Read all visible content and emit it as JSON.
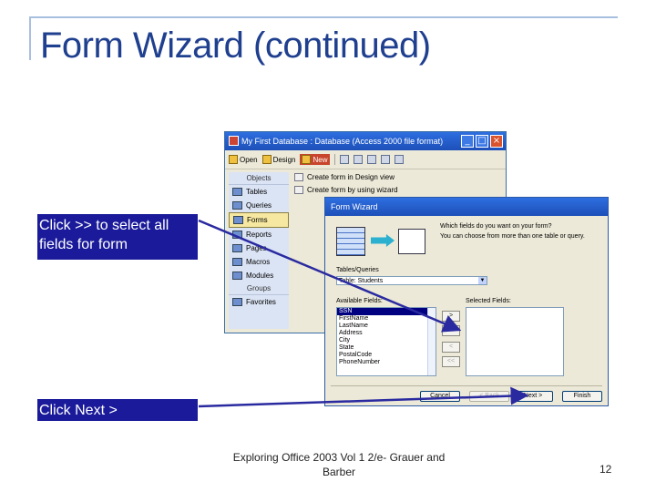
{
  "slide": {
    "title": "Form Wizard (continued)",
    "footer": "Exploring Office 2003 Vol 1 2/e- Grauer and Barber",
    "page_number": "12"
  },
  "db_window": {
    "title": "My First Database : Database (Access 2000 file format)",
    "toolbar": {
      "open": "Open",
      "design": "Design",
      "new": "New"
    },
    "sidebar": {
      "objects_header": "Objects",
      "items": [
        "Tables",
        "Queries",
        "Forms",
        "Reports",
        "Pages",
        "Macros",
        "Modules"
      ],
      "groups_header": "Groups",
      "favorites": "Favorites",
      "selected": "Forms"
    },
    "list": [
      "Create form in Design view",
      "Create form by using wizard"
    ]
  },
  "wizard": {
    "title": "Form Wizard",
    "question_1": "Which fields do you want on your form?",
    "question_2": "You can choose from more than one table or query.",
    "tables_label": "Tables/Queries",
    "table_value": "Table: Students",
    "available_label": "Available Fields:",
    "selected_label": "Selected Fields:",
    "available_fields": [
      "SSN",
      "FirstName",
      "LastName",
      "Address",
      "City",
      "State",
      "PostalCode",
      "PhoneNumber"
    ],
    "selected_field": "SSN",
    "move_buttons": [
      ">",
      ">>",
      "<",
      "<<"
    ],
    "buttons": {
      "cancel": "Cancel",
      "back": "< Back",
      "next": "Next >",
      "finish": "Finish"
    }
  },
  "callouts": {
    "select_all": "Click >> to select all fields for form",
    "next": "Click Next >"
  },
  "colors": {
    "title": "#1f3f8f",
    "callout_bg": "#1a1a9a",
    "arrow": "#2a2aa0"
  }
}
